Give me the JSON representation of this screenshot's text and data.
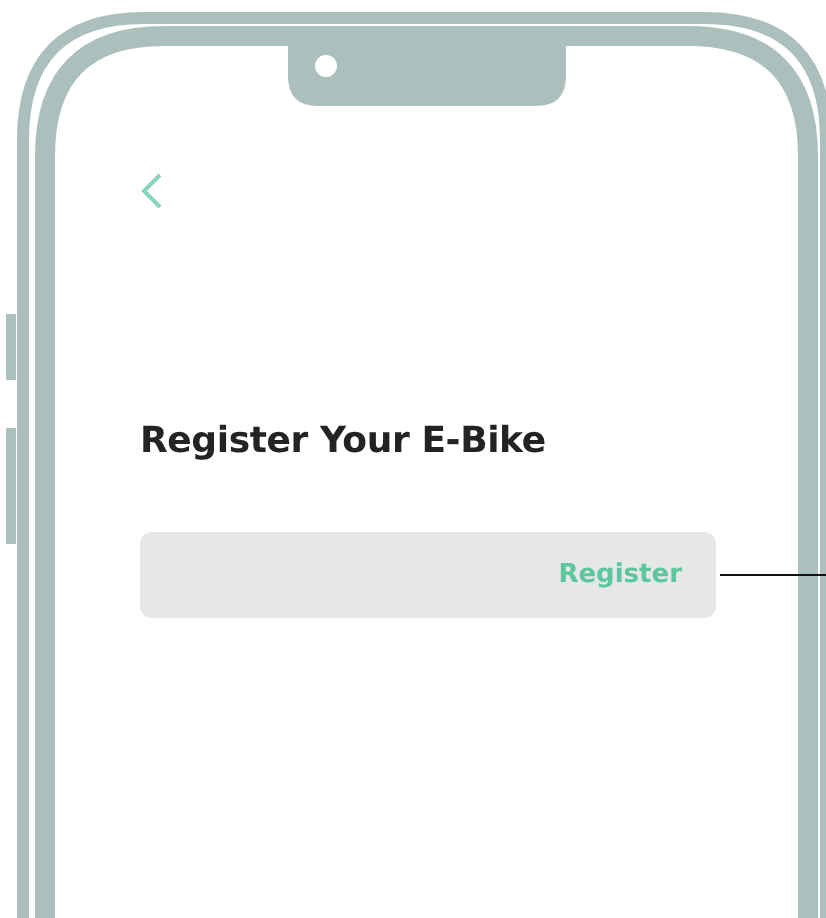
{
  "screen": {
    "title": "Register Your E-Bike",
    "register_button": {
      "label": "Register"
    }
  }
}
